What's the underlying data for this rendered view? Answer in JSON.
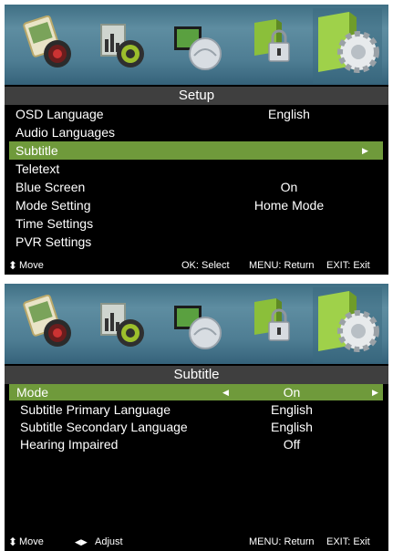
{
  "setup_panel": {
    "title": "Setup",
    "icons": [
      "picture-icon",
      "sound-icon",
      "channel-icon",
      "lock-icon",
      "setup-gear-icon"
    ],
    "items": [
      {
        "label": "OSD Language",
        "value": "English"
      },
      {
        "label": "Audio Languages",
        "value": ""
      },
      {
        "label": "Subtitle",
        "value": "",
        "arrow": "▶"
      },
      {
        "label": "Teletext",
        "value": ""
      },
      {
        "label": "Blue Screen",
        "value": "On"
      },
      {
        "label": "Mode Setting",
        "value": "Home Mode"
      },
      {
        "label": "Time Settings",
        "value": ""
      },
      {
        "label": "PVR Settings",
        "value": ""
      }
    ],
    "footer": {
      "move_icon": "⬍",
      "move": "Move",
      "ok": "OK: Select",
      "menu": "MENU: Return",
      "exit": "EXIT: Exit"
    }
  },
  "subtitle_panel": {
    "title": "Subtitle",
    "icons": [
      "picture-icon",
      "sound-icon",
      "channel-icon",
      "lock-icon",
      "setup-gear-icon"
    ],
    "items": [
      {
        "label": "Mode",
        "value": "On",
        "left_arrow": "◀",
        "right_arrow": "▶"
      },
      {
        "label": "Subtitle Primary Language",
        "value": "English"
      },
      {
        "label": "Subtitle Secondary Language",
        "value": "English"
      },
      {
        "label": "Hearing Impaired",
        "value": "Off"
      }
    ],
    "footer": {
      "move_icon": "⬍",
      "move": "Move",
      "adjust_icon": "◀▶",
      "adjust": "Adjust",
      "menu": "MENU: Return",
      "exit": "EXIT: Exit"
    }
  },
  "colors": {
    "highlight": "#6f9a3b",
    "title_bar": "#3f3f3f",
    "icon_bar": "#4e7d93",
    "panel_bg": "#000000"
  }
}
